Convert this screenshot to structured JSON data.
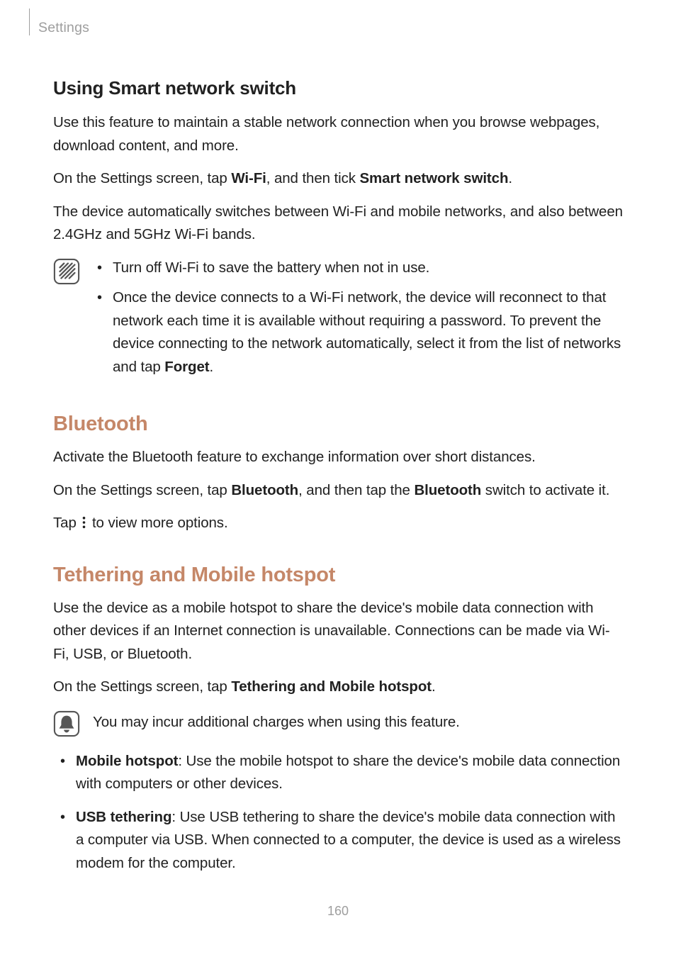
{
  "header": {
    "section": "Settings"
  },
  "smart_switch": {
    "heading": "Using Smart network switch",
    "p1": "Use this feature to maintain a stable network connection when you browse webpages, download content, and more.",
    "p2_pre": "On the Settings screen, tap ",
    "p2_b1": "Wi-Fi",
    "p2_mid": ", and then tick ",
    "p2_b2": "Smart network switch",
    "p2_post": ".",
    "p3": "The device automatically switches between Wi-Fi and mobile networks, and also between 2.4GHz and 5GHz Wi-Fi bands.",
    "note_items": [
      "Turn off Wi-Fi to save the battery when not in use.",
      {
        "pre": "Once the device connects to a Wi-Fi network, the device will reconnect to that network each time it is available without requiring a password. To prevent the device connecting to the network automatically, select it from the list of networks and tap ",
        "b": "Forget",
        "post": "."
      }
    ]
  },
  "bluetooth": {
    "heading": "Bluetooth",
    "p1": "Activate the Bluetooth feature to exchange information over short distances.",
    "p2_pre": "On the Settings screen, tap ",
    "p2_b1": "Bluetooth",
    "p2_mid": ", and then tap the ",
    "p2_b2": "Bluetooth",
    "p2_post": " switch to activate it.",
    "p3_pre": "Tap ",
    "p3_post": " to view more options."
  },
  "tethering": {
    "heading": "Tethering and Mobile hotspot",
    "p1": "Use the device as a mobile hotspot to share the device's mobile data connection with other devices if an Internet connection is unavailable. Connections can be made via Wi-Fi, USB, or Bluetooth.",
    "p2_pre": "On the Settings screen, tap ",
    "p2_b": "Tethering and Mobile hotspot",
    "p2_post": ".",
    "note": "You may incur additional charges when using this feature.",
    "items": [
      {
        "b": "Mobile hotspot",
        "post": ": Use the mobile hotspot to share the device's mobile data connection with computers or other devices."
      },
      {
        "b": "USB tethering",
        "post": ": Use USB tethering to share the device's mobile data connection with a computer via USB. When connected to a computer, the device is used as a wireless modem for the computer."
      }
    ]
  },
  "page_number": "160"
}
